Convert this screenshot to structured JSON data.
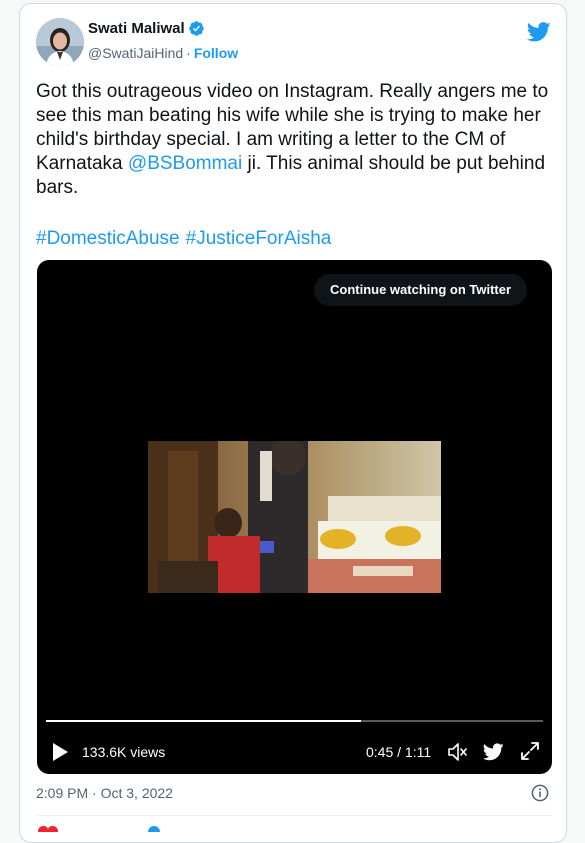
{
  "author": {
    "name": "Swati Maliwal",
    "handle": "@SwatiJaiHind",
    "separator": "·",
    "follow_label": "Follow"
  },
  "tweet": {
    "text_before_mention": "Got this outrageous video on Instagram. Really angers me to see this man beating his wife while she is trying to make her child's birthday special. I am writing a letter to the CM of Karnataka ",
    "mention": "@BSBommai",
    "text_after_mention": " ji. This animal should be put behind bars.",
    "hashtags": [
      "#DomesticAbuse",
      "#JusticeForAisha"
    ]
  },
  "video": {
    "continue_label": "Continue watching on Twitter",
    "views": "133.6K views",
    "time": "0:45 / 1:11",
    "progress": 0.634
  },
  "timestamp": "2:09 PM · Oct 3, 2022",
  "icons": {
    "verified": "verified-badge-icon",
    "brand": "twitter-bird-icon",
    "play": "play-icon",
    "volume": "volume-icon",
    "fullscreen": "fullscreen-icon",
    "info": "info-icon"
  },
  "colors": {
    "accent": "#1d9bf0",
    "text": "#0f1419",
    "secondary": "#536471",
    "video_bg": "#000000"
  }
}
